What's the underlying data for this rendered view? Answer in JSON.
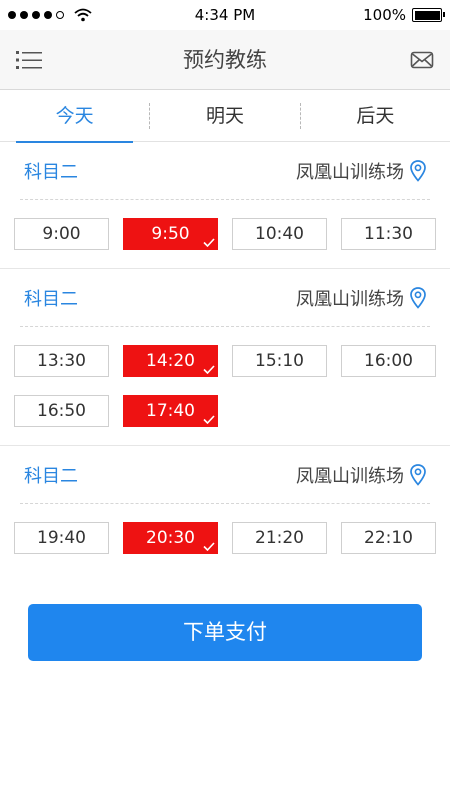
{
  "status_bar": {
    "time": "4:34 PM",
    "battery": "100%",
    "battery_level": 1.0
  },
  "header": {
    "title": "预约教练",
    "menu_icon": "menu-icon",
    "mail_icon": "mail-icon"
  },
  "tabs": [
    {
      "label": "今天",
      "active": true
    },
    {
      "label": "明天",
      "active": false
    },
    {
      "label": "后天",
      "active": false
    }
  ],
  "sections": [
    {
      "subject": "科目二",
      "venue": "凤凰山训练场",
      "slots": [
        {
          "time": "9:00",
          "selected": false
        },
        {
          "time": "9:50",
          "selected": true
        },
        {
          "time": "10:40",
          "selected": false
        },
        {
          "time": "11:30",
          "selected": false
        }
      ]
    },
    {
      "subject": "科目二",
      "venue": "凤凰山训练场",
      "slots": [
        {
          "time": "13:30",
          "selected": false
        },
        {
          "time": "14:20",
          "selected": true
        },
        {
          "time": "15:10",
          "selected": false
        },
        {
          "time": "16:00",
          "selected": false
        },
        {
          "time": "16:50",
          "selected": false
        },
        {
          "time": "17:40",
          "selected": true
        }
      ]
    },
    {
      "subject": "科目二",
      "venue": "凤凰山训练场",
      "slots": [
        {
          "time": "19:40",
          "selected": false
        },
        {
          "time": "20:30",
          "selected": true
        },
        {
          "time": "21:20",
          "selected": false
        },
        {
          "time": "22:10",
          "selected": false
        }
      ]
    }
  ],
  "pay_button": {
    "label": "下单支付"
  },
  "colors": {
    "accent": "#2a86e0",
    "selected": "#ee1212",
    "button": "#1f86ee"
  }
}
